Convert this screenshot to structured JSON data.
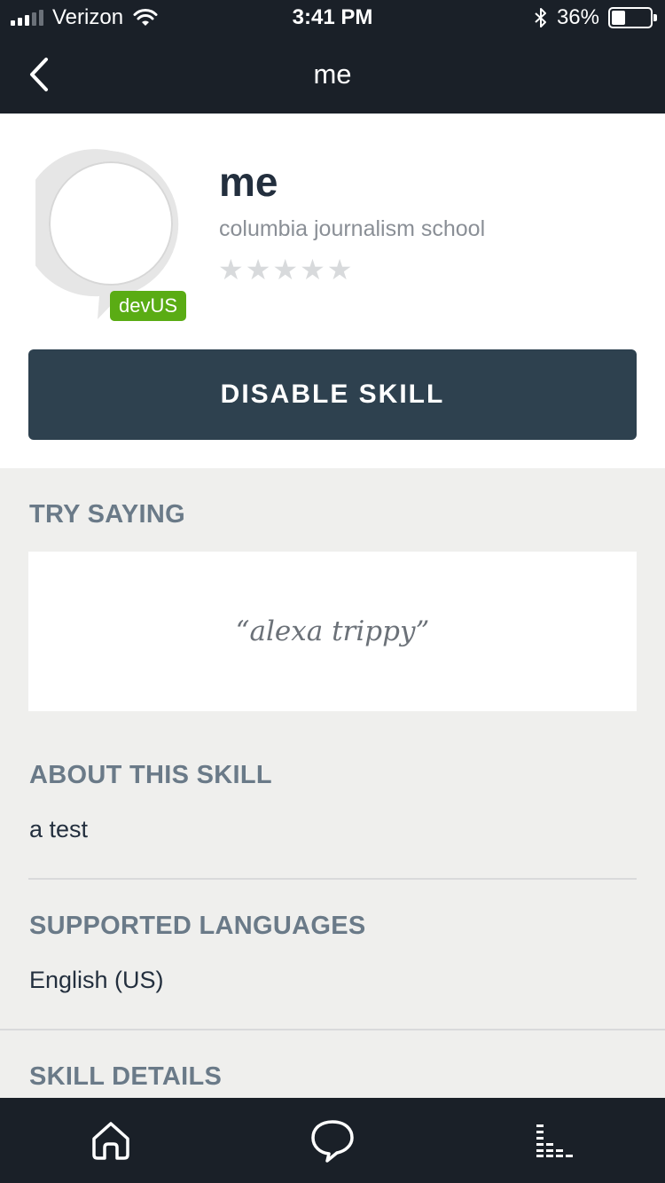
{
  "status_bar": {
    "carrier": "Verizon",
    "time": "3:41 PM",
    "battery_percent": "36%",
    "battery_level": 0.36,
    "icons": [
      "signal-icon",
      "wifi-icon",
      "bluetooth-icon",
      "battery-icon"
    ]
  },
  "nav": {
    "title": "me",
    "back_icon": "chevron-left-icon"
  },
  "skill": {
    "name": "me",
    "author": "columbia journalism school",
    "badge": "devUS",
    "rating": 0,
    "rating_max": 5,
    "action_label": "DISABLE SKILL"
  },
  "try_saying": {
    "heading": "TRY SAYING",
    "utterance": "“alexa trippy”"
  },
  "about": {
    "heading": "ABOUT THIS SKILL",
    "text": "a test"
  },
  "languages": {
    "heading": "SUPPORTED LANGUAGES",
    "text": "English (US)"
  },
  "details": {
    "heading": "SKILL DETAILS"
  },
  "tab_bar": {
    "tabs": [
      "home-icon",
      "chat-icon",
      "activity-icon"
    ]
  },
  "colors": {
    "dark_bar": "#1a2028",
    "button": "#2e414f",
    "badge": "#5aac14",
    "section_heading": "#6a7a88",
    "background": "#efefed"
  }
}
